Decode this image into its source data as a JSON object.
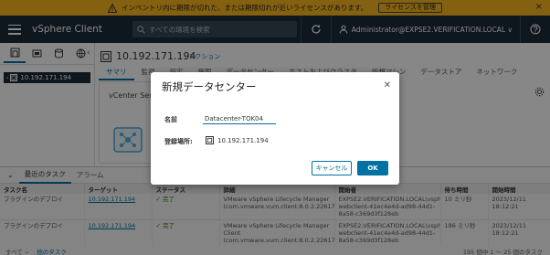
{
  "banner": {
    "message": "インベントリ内に期限が切れた、または期限切れが近いライセンスがあります。",
    "button": "ライセンスを管理"
  },
  "header": {
    "app_title": "vSphere Client",
    "search_placeholder": "すべての環境を検索",
    "user": "Administrator@EXPSE2.VERIFICATION.LOCAL ∨"
  },
  "sidebar": {
    "tree_item": "10.192.171.194"
  },
  "object": {
    "title": "10.192.171.194",
    "actions": ": アクション",
    "tabs": [
      "サマリ",
      "監視",
      "設定",
      "権限",
      "データセンター",
      "ホストおよびクラスタ",
      "仮想マシン",
      "データストア",
      "ネットワーク"
    ],
    "card_title": "vCenter Server"
  },
  "tasks": {
    "tabs": [
      "最近のタスク",
      "アラーム"
    ],
    "columns": [
      "タスク名",
      "ターゲット",
      "ステータス",
      "詳細",
      "開始者",
      "待ち時間",
      "開始時間"
    ],
    "rows": [
      {
        "name": "プラグインのデプロイ",
        "target": "10.192.171.194",
        "status": "✓ 完了",
        "detail": "VMware vSphere Lifecycle Manager (com.vmware.vum.client:8.0.2.22617221)",
        "initiator": "EXPSE2.VERIFICATION.LOCAL\\vsphere-webclient-41ec4e4d-ad98-44d1-8a58-c369d3f128eb",
        "wait": "10 ミリ秒",
        "start": "2023/12/11 18:12:21"
      },
      {
        "name": "プラグインのデプロイ",
        "target": "10.192.171.194",
        "status": "✓ 完了",
        "detail": "VMware vSphere Lifecycle Manager Client (com.vmware.vum.client:8.0.2.22617221)",
        "initiator": "EXPSE2.VERIFICATION.LOCAL\\vsphere-webclient-41ec4e4d-ad98-44d1-8a58-c369d3f128eb",
        "wait": "186 ミリ秒",
        "start": "2023/12/11 18:12:21"
      }
    ],
    "footer_filter": "すべて",
    "footer_more": "他のタスク",
    "footer_count": "195 個中 1 ～ 25 個のタスク"
  },
  "modal": {
    "title": "新規データセンター",
    "name_label": "名前",
    "name_value": "Datacenter-TOK04",
    "location_label": "登録場所:",
    "location_value": "10.192.171.194",
    "cancel": "キャンセル",
    "ok": "OK"
  }
}
